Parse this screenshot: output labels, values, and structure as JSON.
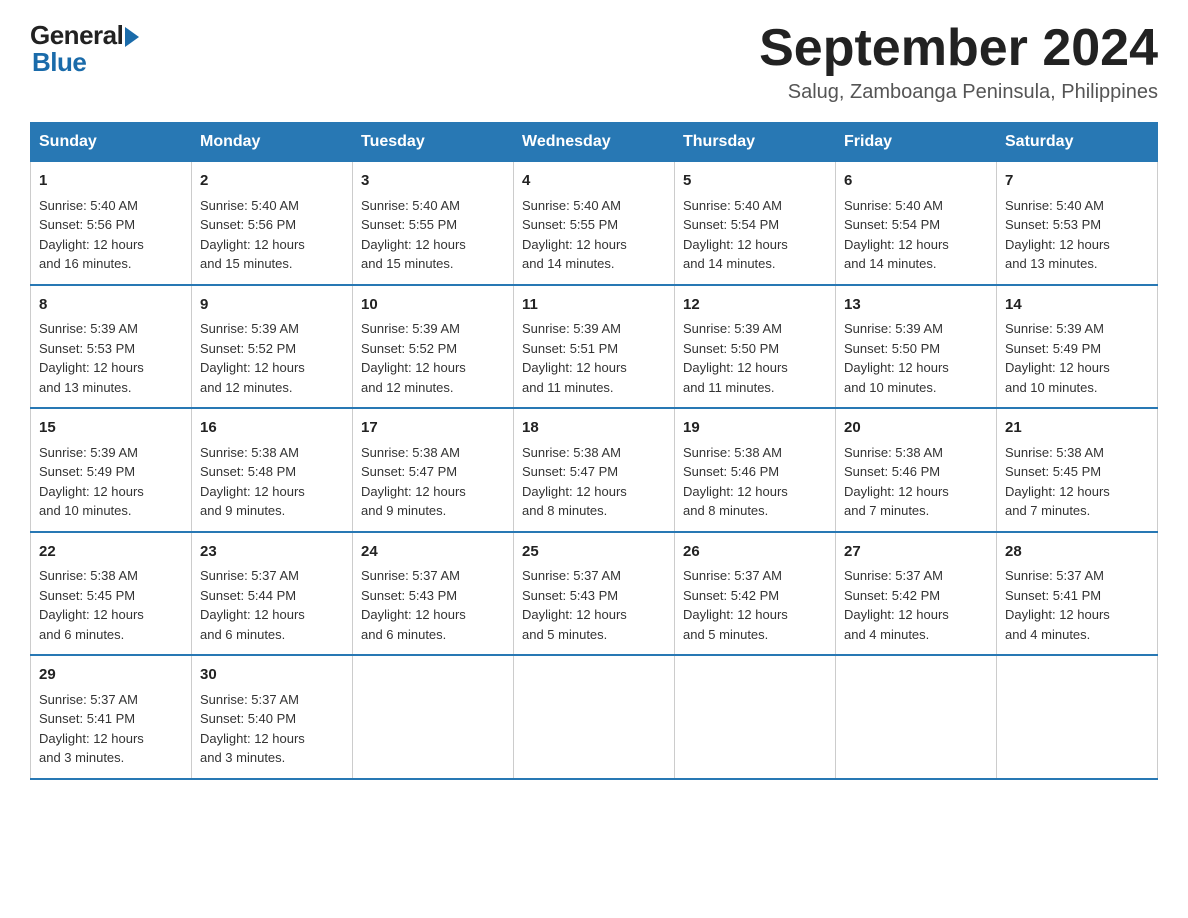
{
  "logo": {
    "general": "General",
    "blue": "Blue"
  },
  "title": "September 2024",
  "subtitle": "Salug, Zamboanga Peninsula, Philippines",
  "days_of_week": [
    "Sunday",
    "Monday",
    "Tuesday",
    "Wednesday",
    "Thursday",
    "Friday",
    "Saturday"
  ],
  "weeks": [
    [
      {
        "day": "1",
        "sunrise": "5:40 AM",
        "sunset": "5:56 PM",
        "daylight": "12 hours and 16 minutes."
      },
      {
        "day": "2",
        "sunrise": "5:40 AM",
        "sunset": "5:56 PM",
        "daylight": "12 hours and 15 minutes."
      },
      {
        "day": "3",
        "sunrise": "5:40 AM",
        "sunset": "5:55 PM",
        "daylight": "12 hours and 15 minutes."
      },
      {
        "day": "4",
        "sunrise": "5:40 AM",
        "sunset": "5:55 PM",
        "daylight": "12 hours and 14 minutes."
      },
      {
        "day": "5",
        "sunrise": "5:40 AM",
        "sunset": "5:54 PM",
        "daylight": "12 hours and 14 minutes."
      },
      {
        "day": "6",
        "sunrise": "5:40 AM",
        "sunset": "5:54 PM",
        "daylight": "12 hours and 14 minutes."
      },
      {
        "day": "7",
        "sunrise": "5:40 AM",
        "sunset": "5:53 PM",
        "daylight": "12 hours and 13 minutes."
      }
    ],
    [
      {
        "day": "8",
        "sunrise": "5:39 AM",
        "sunset": "5:53 PM",
        "daylight": "12 hours and 13 minutes."
      },
      {
        "day": "9",
        "sunrise": "5:39 AM",
        "sunset": "5:52 PM",
        "daylight": "12 hours and 12 minutes."
      },
      {
        "day": "10",
        "sunrise": "5:39 AM",
        "sunset": "5:52 PM",
        "daylight": "12 hours and 12 minutes."
      },
      {
        "day": "11",
        "sunrise": "5:39 AM",
        "sunset": "5:51 PM",
        "daylight": "12 hours and 11 minutes."
      },
      {
        "day": "12",
        "sunrise": "5:39 AM",
        "sunset": "5:50 PM",
        "daylight": "12 hours and 11 minutes."
      },
      {
        "day": "13",
        "sunrise": "5:39 AM",
        "sunset": "5:50 PM",
        "daylight": "12 hours and 10 minutes."
      },
      {
        "day": "14",
        "sunrise": "5:39 AM",
        "sunset": "5:49 PM",
        "daylight": "12 hours and 10 minutes."
      }
    ],
    [
      {
        "day": "15",
        "sunrise": "5:39 AM",
        "sunset": "5:49 PM",
        "daylight": "12 hours and 10 minutes."
      },
      {
        "day": "16",
        "sunrise": "5:38 AM",
        "sunset": "5:48 PM",
        "daylight": "12 hours and 9 minutes."
      },
      {
        "day": "17",
        "sunrise": "5:38 AM",
        "sunset": "5:47 PM",
        "daylight": "12 hours and 9 minutes."
      },
      {
        "day": "18",
        "sunrise": "5:38 AM",
        "sunset": "5:47 PM",
        "daylight": "12 hours and 8 minutes."
      },
      {
        "day": "19",
        "sunrise": "5:38 AM",
        "sunset": "5:46 PM",
        "daylight": "12 hours and 8 minutes."
      },
      {
        "day": "20",
        "sunrise": "5:38 AM",
        "sunset": "5:46 PM",
        "daylight": "12 hours and 7 minutes."
      },
      {
        "day": "21",
        "sunrise": "5:38 AM",
        "sunset": "5:45 PM",
        "daylight": "12 hours and 7 minutes."
      }
    ],
    [
      {
        "day": "22",
        "sunrise": "5:38 AM",
        "sunset": "5:45 PM",
        "daylight": "12 hours and 6 minutes."
      },
      {
        "day": "23",
        "sunrise": "5:37 AM",
        "sunset": "5:44 PM",
        "daylight": "12 hours and 6 minutes."
      },
      {
        "day": "24",
        "sunrise": "5:37 AM",
        "sunset": "5:43 PM",
        "daylight": "12 hours and 6 minutes."
      },
      {
        "day": "25",
        "sunrise": "5:37 AM",
        "sunset": "5:43 PM",
        "daylight": "12 hours and 5 minutes."
      },
      {
        "day": "26",
        "sunrise": "5:37 AM",
        "sunset": "5:42 PM",
        "daylight": "12 hours and 5 minutes."
      },
      {
        "day": "27",
        "sunrise": "5:37 AM",
        "sunset": "5:42 PM",
        "daylight": "12 hours and 4 minutes."
      },
      {
        "day": "28",
        "sunrise": "5:37 AM",
        "sunset": "5:41 PM",
        "daylight": "12 hours and 4 minutes."
      }
    ],
    [
      {
        "day": "29",
        "sunrise": "5:37 AM",
        "sunset": "5:41 PM",
        "daylight": "12 hours and 3 minutes."
      },
      {
        "day": "30",
        "sunrise": "5:37 AM",
        "sunset": "5:40 PM",
        "daylight": "12 hours and 3 minutes."
      },
      null,
      null,
      null,
      null,
      null
    ]
  ],
  "labels": {
    "sunrise": "Sunrise: ",
    "sunset": "Sunset: ",
    "daylight": "Daylight: "
  }
}
